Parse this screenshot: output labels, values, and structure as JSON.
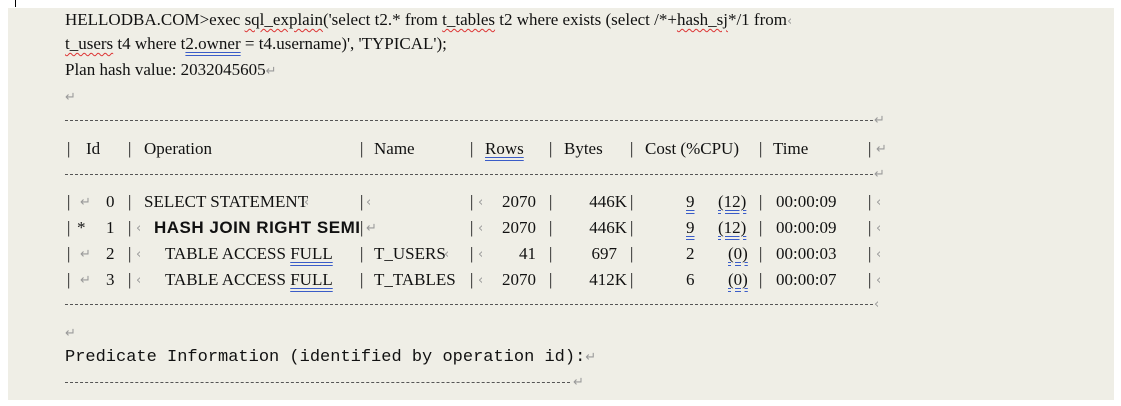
{
  "sql": {
    "line1_prefix": "HELLODBA.COM>exec ",
    "line1_sqlexplain": "sql_explain",
    "line1_mid": "('select t2.* from ",
    "line1_ttables": "t_tables",
    "line1_rest": " t2 where exists (select /*+",
    "line1_hashsj": "hash_sj",
    "line1_end": "*/1 from",
    "line2_tusers": "t_users",
    "line2_mid": " t4 where t",
    "line2_owner": "2.owner",
    "line2_end": " = t4.username)', 'TYPICAL');",
    "plan_hash": "Plan hash value: 2032045605"
  },
  "marks": {
    "para": "↵",
    "small": "‹"
  },
  "plan": {
    "headers": {
      "id": "Id",
      "operation": "Operation",
      "name": "Name",
      "rows": "Rows",
      "bytes": "Bytes",
      "cost": "Cost (%CPU)",
      "time": "Time"
    },
    "rows": [
      {
        "marker": "↵",
        "id": "0",
        "operation": "SELECT STATEMENT",
        "name": "",
        "rows": "2070",
        "bytes": "446K",
        "cost": "9",
        "cpu": "(12)",
        "time": "00:00:09"
      },
      {
        "marker": "*",
        "id": "1",
        "operation": "HASH JOIN RIGHT SEMI",
        "name": "",
        "rows": "2070",
        "bytes": "446K",
        "cost": "9",
        "cpu": "(12)",
        "time": "00:00:09"
      },
      {
        "marker": "↵",
        "id": "2",
        "operation": "TABLE ACCESS ",
        "op_full": "FULL",
        "name": "T_USERS",
        "rows": "41",
        "bytes": "697",
        "cost": "2",
        "cpu": "(0)",
        "time": "00:00:03"
      },
      {
        "marker": "↵",
        "id": "3",
        "operation": "TABLE ACCESS ",
        "op_full": "FULL",
        "name": "T_TABLES",
        "rows": "2070",
        "bytes": "412K",
        "cost": "6",
        "cpu": "(0)",
        "time": "00:00:07"
      }
    ]
  },
  "predicate": {
    "title": "Predicate Information (identified by operation id):"
  }
}
